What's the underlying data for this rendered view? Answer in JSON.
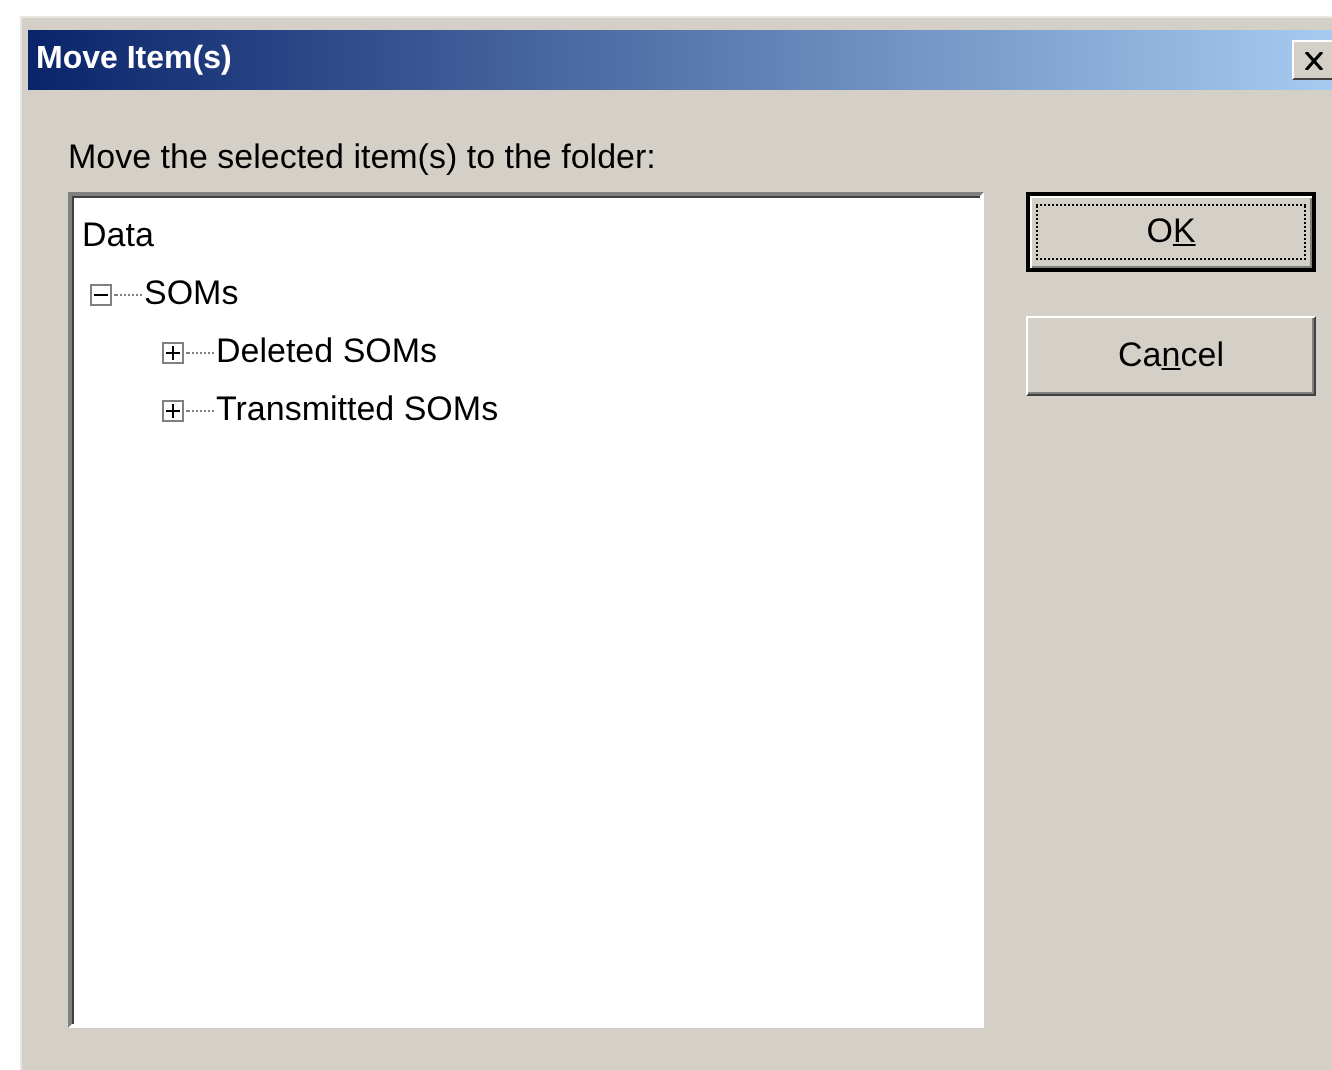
{
  "window": {
    "title": "Move Item(s)"
  },
  "prompt": "Move the selected item(s) to the folder:",
  "tree": {
    "label": "Data",
    "children": [
      {
        "label": "SOMs",
        "expanded": true,
        "children": [
          {
            "label": "Deleted SOMs",
            "expanded": false
          },
          {
            "label": "Transmitted SOMs",
            "expanded": false
          }
        ]
      }
    ]
  },
  "buttons": [
    {
      "label_parts": [
        {
          "text": "O",
          "underlined": false
        },
        {
          "text": "K",
          "underlined": true
        }
      ],
      "default": true,
      "focused": true
    },
    {
      "label_parts": [
        {
          "text": "Ca",
          "underlined": false
        },
        {
          "text": "n",
          "underlined": true
        },
        {
          "text": "cel",
          "underlined": false
        }
      ],
      "default": false,
      "focused": false
    }
  ]
}
